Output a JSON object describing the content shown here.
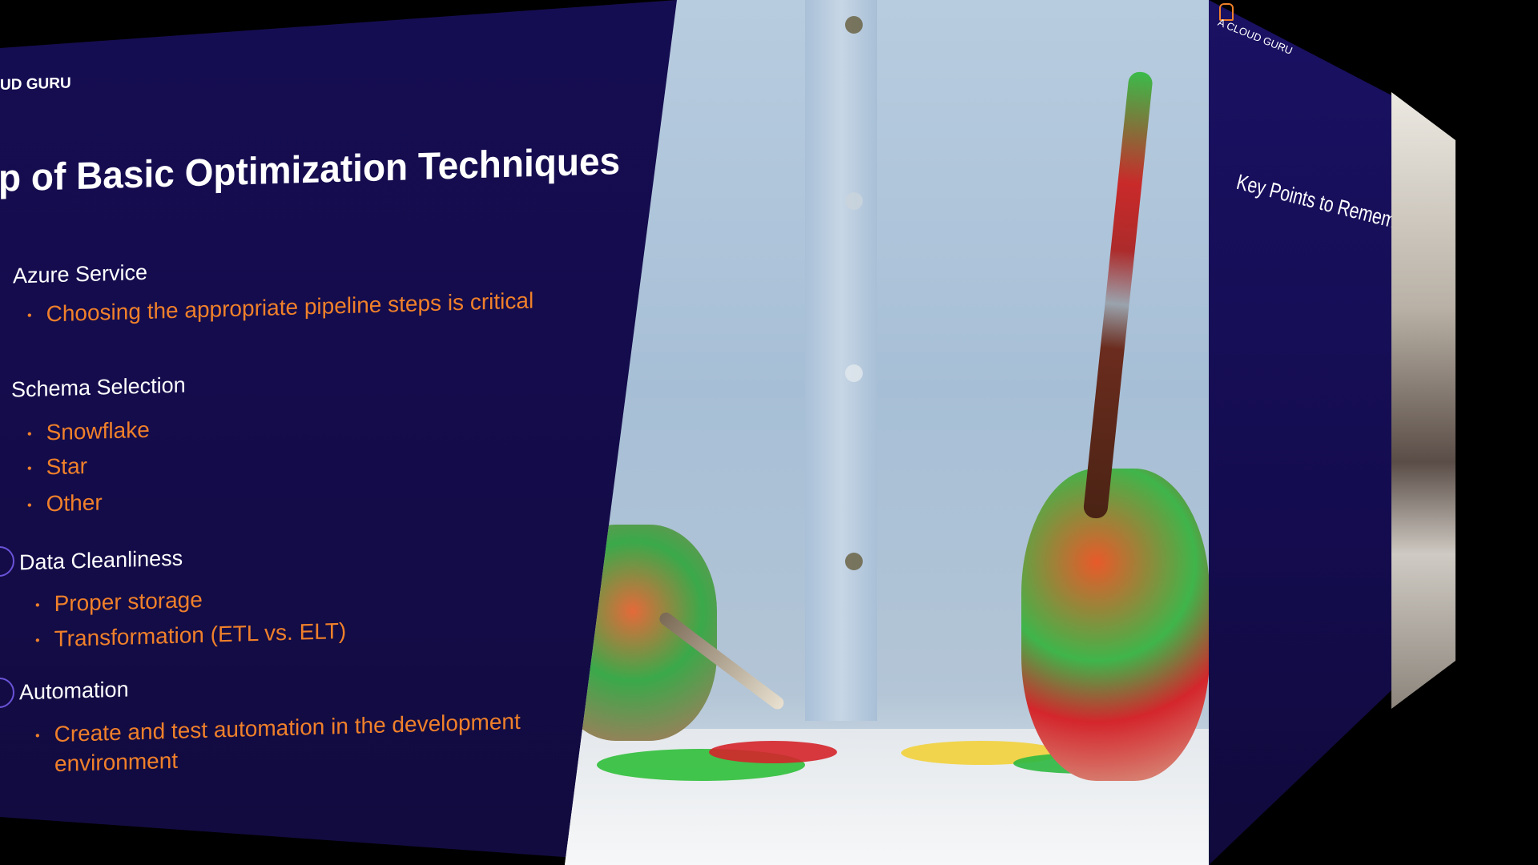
{
  "left_slide": {
    "brand": "UD GURU",
    "title": "p of Basic Optimization Techniques",
    "sections": [
      {
        "heading": "Azure Service",
        "bullets": [
          "Choosing the appropriate pipeline steps is critical"
        ]
      },
      {
        "heading": "Schema Selection",
        "bullets": [
          "Snowflake",
          "Star",
          "Other"
        ]
      },
      {
        "heading": "Data Cleanliness",
        "bullets": [
          "Proper storage",
          "Transformation (ETL vs. ELT)"
        ]
      },
      {
        "heading": "Automation",
        "bullets": [
          "Create and test automation in the development",
          "environment"
        ]
      }
    ],
    "bullet_glyph": "•"
  },
  "right_slide": {
    "brand": "A CLOUD GURU",
    "title": "Key Points to Remember"
  },
  "colors": {
    "slide_bg": "#150d52",
    "heading_text": "#ffffff",
    "bullet_text": "#f0802a",
    "accent_circle": "#6a53d8"
  },
  "photo": {
    "icon": "paint-brush-hands-photo"
  }
}
